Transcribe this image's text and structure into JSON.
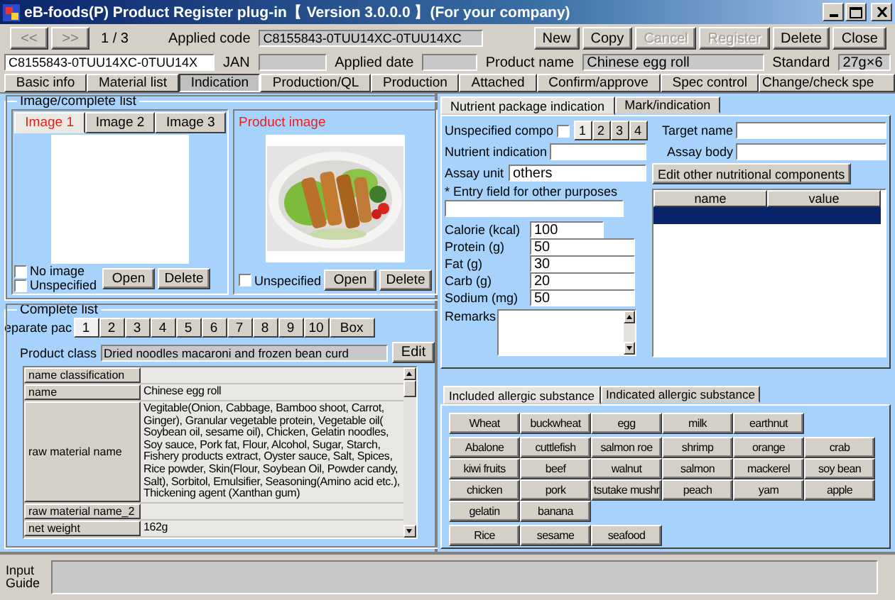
{
  "window": {
    "title": "eB-foods(P) Product Register plug-in【 Version 3.0.0.0 】(For your company)"
  },
  "toolbar": {
    "prev_button": "<<",
    "next_button": ">>",
    "record_position": "1 / 3",
    "applied_code_label": "Applied code",
    "applied_code": "C8155843-0TUU14XC-0TUU14XC",
    "buttons": [
      {
        "label": "New",
        "disabled": false
      },
      {
        "label": "Copy",
        "disabled": false
      },
      {
        "label": "Cancel",
        "disabled": true
      },
      {
        "label": "Register",
        "disabled": true
      },
      {
        "label": "Delete",
        "disabled": false
      },
      {
        "label": "Close",
        "disabled": false
      }
    ]
  },
  "info_row": {
    "code": "C8155843-0TUU14XC-0TUU14X",
    "jan_label": "JAN",
    "applied_date_label": "Applied date",
    "product_name_label": "Product name",
    "product_name": "Chinese egg roll",
    "standard_label": "Standard",
    "standard": "27g×6"
  },
  "tabs": [
    {
      "label": "Basic info",
      "selected": false
    },
    {
      "label": "Material list",
      "selected": false
    },
    {
      "label": "Indication",
      "selected": true
    },
    {
      "label": "Production/QL",
      "selected": false
    },
    {
      "label": "Production",
      "selected": false
    },
    {
      "label": "Attached",
      "selected": false
    },
    {
      "label": "Confirm/approve",
      "selected": false
    },
    {
      "label": "Spec control",
      "selected": false
    },
    {
      "label": "Change/check spe",
      "selected": false
    }
  ],
  "image_panel": {
    "title": "Image/complete list",
    "image_tabs": [
      {
        "label": "Image 1",
        "selected": true
      },
      {
        "label": "Image 2",
        "selected": false
      },
      {
        "label": "Image 3",
        "selected": false
      }
    ],
    "no_image": {
      "label": "No image",
      "checked": false
    },
    "unspecified": {
      "label": "Unspecified",
      "checked": false
    },
    "open_button": "Open",
    "delete_button": "Delete",
    "product_image_label": "Product image",
    "product_unspecified": {
      "label": "Unspecified",
      "checked": false
    },
    "product_open_button": "Open",
    "product_delete_button": "Delete"
  },
  "complete_list": {
    "title": "Complete list",
    "pack_label": "eparate pac",
    "pack_tabs": [
      {
        "label": "1",
        "selected": true
      },
      {
        "label": "2",
        "selected": false
      },
      {
        "label": "3",
        "selected": false
      },
      {
        "label": "4",
        "selected": false
      },
      {
        "label": "5",
        "selected": false
      },
      {
        "label": "6",
        "selected": false
      },
      {
        "label": "7",
        "selected": false
      },
      {
        "label": "8",
        "selected": false
      },
      {
        "label": "9",
        "selected": false
      },
      {
        "label": "10",
        "selected": false
      },
      {
        "label": "Box",
        "selected": false
      }
    ],
    "product_class_label": "Product class",
    "product_class": "Dried noodles macaroni and frozen bean curd",
    "edit_button": "Edit",
    "rows": [
      {
        "label": "name classification"
      },
      {
        "label": "name",
        "value": "Chinese egg roll"
      },
      {
        "label": "raw material name",
        "value": "Vegitable(Onion, Cabbage, Bamboo shoot, Carrot, Ginger), Granular vegetable protein, Vegetable oil( Soybean oil, sesame oil), Chicken, Gelatin noodles, Soy sauce, Pork fat, Flour, Alcohol, Sugar, Starch, Fishery products extract, Oyster sauce, Salt, Spices, Rice powder, Skin(Flour, Soybean Oil, Powder candy, Salt), Sorbitol, Emulsifier, Seasoning(Amino acid etc.), Thickening agent (Xanthan gum)"
      },
      {
        "label": "raw material name_2"
      },
      {
        "label": "net weight",
        "value": "162g"
      }
    ]
  },
  "nutrient_tabs": [
    {
      "label": "Nutrient package indication",
      "selected": true
    },
    {
      "label": "Mark/indication",
      "selected": false
    }
  ],
  "nutrient": {
    "unspecified_label": "Unspecified compo",
    "unspecified_checked": false,
    "component_tabs": [
      {
        "label": "1",
        "selected": true
      },
      {
        "label": "2",
        "selected": false
      },
      {
        "label": "3",
        "selected": false
      },
      {
        "label": "4",
        "selected": false
      }
    ],
    "target_name_label": "Target name",
    "assay_body_label": "Assay body",
    "nutrient_indication_label": "Nutrient indication",
    "assay_unit_label": "Assay unit",
    "assay_unit": "others",
    "other_purposes_label": "* Entry field for other purposes",
    "edit_other_button": "Edit other nutritional components",
    "values": [
      {
        "label": "Calorie (kcal)",
        "value": "100"
      },
      {
        "label": "Protein (g)",
        "value": "50"
      },
      {
        "label": "Fat (g)",
        "value": "30"
      },
      {
        "label": "Carb (g)",
        "value": "20"
      },
      {
        "label": "Sodium (mg)",
        "value": "50"
      }
    ],
    "remarks_label": "Remarks",
    "grid_columns": [
      "name",
      "value"
    ],
    "grid_rows": [
      {
        "selected": true
      }
    ]
  },
  "allergen_tabs": [
    {
      "label": "Included allergic substance",
      "selected": true
    },
    {
      "label": "Indicated allergic substance",
      "selected": false
    }
  ],
  "allergen_groups": [
    [
      "Wheat",
      "buckwheat",
      "egg",
      "milk",
      "earthnut"
    ],
    [
      "Abalone",
      "cuttlefish",
      "salmon roe",
      "shrimp",
      "orange",
      "crab",
      "kiwi fruits",
      "beef",
      "walnut",
      "salmon",
      "mackerel",
      "soy bean",
      "chicken",
      "pork",
      "tsutake mushr",
      "peach",
      "yam",
      "apple",
      "gelatin",
      "banana"
    ],
    [
      "Rice",
      "sesame",
      "seafood"
    ]
  ],
  "input_guide": {
    "label": "Input Guide"
  }
}
